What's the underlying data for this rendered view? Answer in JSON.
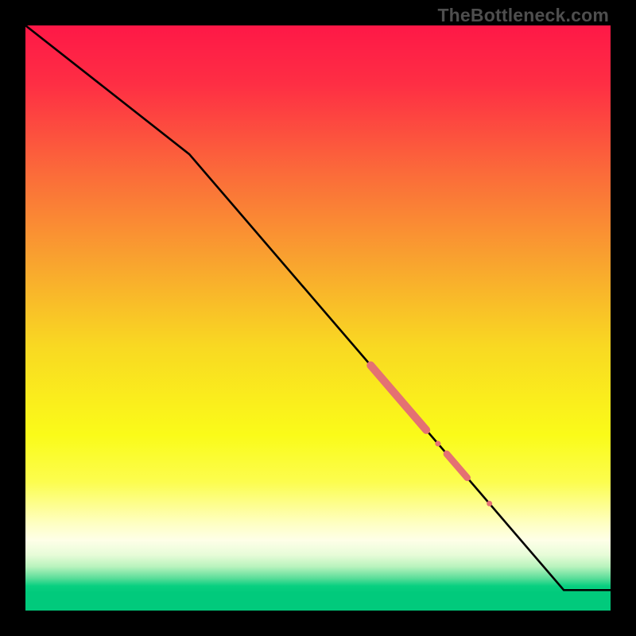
{
  "watermark": "TheBottleneck.com",
  "chart_data": {
    "type": "line",
    "title": "",
    "xlabel": "",
    "ylabel": "",
    "xlim": [
      0,
      100
    ],
    "ylim": [
      0,
      100
    ],
    "gradient_stops": [
      {
        "offset": 0,
        "color": "#fe1847"
      },
      {
        "offset": 0.1,
        "color": "#fe2e44"
      },
      {
        "offset": 0.25,
        "color": "#fb6a3a"
      },
      {
        "offset": 0.4,
        "color": "#f9a22f"
      },
      {
        "offset": 0.55,
        "color": "#f9d922"
      },
      {
        "offset": 0.7,
        "color": "#fafb19"
      },
      {
        "offset": 0.78,
        "color": "#fcfd4e"
      },
      {
        "offset": 0.85,
        "color": "#feffc1"
      },
      {
        "offset": 0.88,
        "color": "#feffe8"
      },
      {
        "offset": 0.905,
        "color": "#e7fcd8"
      },
      {
        "offset": 0.925,
        "color": "#b8f3bd"
      },
      {
        "offset": 0.945,
        "color": "#59dd99"
      },
      {
        "offset": 0.958,
        "color": "#08cf80"
      },
      {
        "offset": 0.97,
        "color": "#01ca7c"
      },
      {
        "offset": 1.0,
        "color": "#01ca7c"
      }
    ],
    "series": [
      {
        "name": "curve",
        "x": [
          0,
          28,
          92,
          100
        ],
        "y": [
          100,
          78,
          3.5,
          3.5
        ],
        "note": "y is a metric that starts at 100 at x=0, inflects around x≈28, then declines roughly linearly to ≈3.5 by x≈92 and stays flat; axes are unlabeled so values are estimated from geometry only"
      }
    ],
    "markers": [
      {
        "name": "thick-segment-1",
        "x_start": 59,
        "x_end": 68.5,
        "radius": 5
      },
      {
        "name": "dot-1",
        "x": 70.5,
        "radius": 3.5
      },
      {
        "name": "thick-segment-2",
        "x_start": 72,
        "x_end": 75.5,
        "radius": 4.3
      },
      {
        "name": "dot-2",
        "x": 79.3,
        "radius": 3.5
      }
    ],
    "colors": {
      "line": "#000000",
      "marker": "#e47172"
    }
  }
}
